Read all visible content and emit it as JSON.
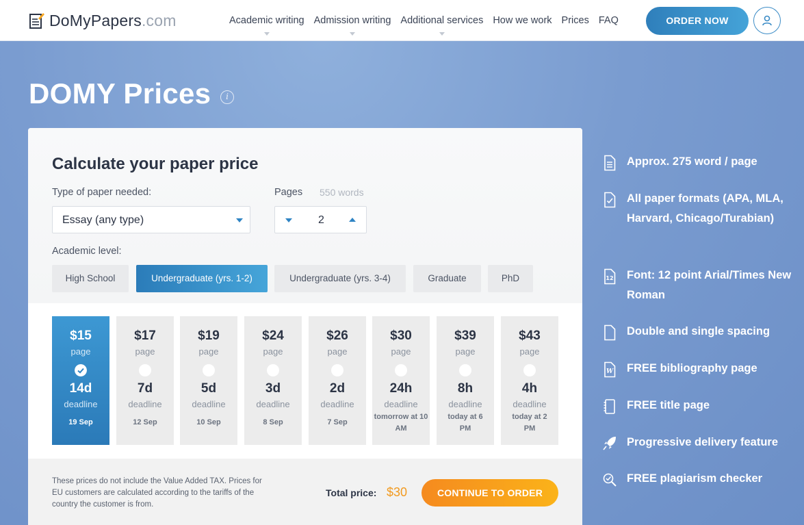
{
  "header": {
    "logo": {
      "main": "DoMyPapers",
      "suffix": ".com"
    },
    "nav": [
      {
        "label": "Academic writing",
        "has_dropdown": true
      },
      {
        "label": "Admission writing",
        "has_dropdown": true
      },
      {
        "label": "Additional services",
        "has_dropdown": true
      },
      {
        "label": "How we work",
        "has_dropdown": false
      },
      {
        "label": "Prices",
        "has_dropdown": false
      },
      {
        "label": "FAQ",
        "has_dropdown": false
      }
    ],
    "order_button": "ORDER NOW",
    "user_icon": "user-icon"
  },
  "page": {
    "title": "DOMY Prices",
    "info_glyph": "i"
  },
  "calculator": {
    "title": "Calculate your paper price",
    "type_label": "Type of paper needed:",
    "type_value": "Essay (any type)",
    "pages_label": "Pages",
    "words_hint": "550 words",
    "pages_value": "2",
    "level_label": "Academic level:",
    "levels": [
      {
        "label": "High School",
        "active": false
      },
      {
        "label": "Undergraduate (yrs. 1-2)",
        "active": true
      },
      {
        "label": "Undergraduate (yrs. 3-4)",
        "active": false
      },
      {
        "label": "Graduate",
        "active": false
      },
      {
        "label": "PhD",
        "active": false
      }
    ],
    "deadlines": [
      {
        "price": "$15",
        "unit": "page",
        "duration": "14d",
        "word": "deadline",
        "date": "19 Sep",
        "selected": true
      },
      {
        "price": "$17",
        "unit": "page",
        "duration": "7d",
        "word": "deadline",
        "date": "12 Sep",
        "selected": false
      },
      {
        "price": "$19",
        "unit": "page",
        "duration": "5d",
        "word": "deadline",
        "date": "10 Sep",
        "selected": false
      },
      {
        "price": "$24",
        "unit": "page",
        "duration": "3d",
        "word": "deadline",
        "date": "8 Sep",
        "selected": false
      },
      {
        "price": "$26",
        "unit": "page",
        "duration": "2d",
        "word": "deadline",
        "date": "7 Sep",
        "selected": false
      },
      {
        "price": "$30",
        "unit": "page",
        "duration": "24h",
        "word": "deadline",
        "date": "tomorrow at 10 AM",
        "selected": false
      },
      {
        "price": "$39",
        "unit": "page",
        "duration": "8h",
        "word": "deadline",
        "date": "today at 6 PM",
        "selected": false
      },
      {
        "price": "$43",
        "unit": "page",
        "duration": "4h",
        "word": "deadline",
        "date": "today at 2 PM",
        "selected": false
      }
    ],
    "vat_note": "These prices do not include the Value Added TAX. Prices for EU customers are calculated according to the tariffs of the country the customer is from.",
    "total_label": "Total price:",
    "total_value": "$30",
    "continue_button": "CONTINUE TO ORDER"
  },
  "features": [
    {
      "icon": "document-lines-icon",
      "text": "Approx. 275 word / page"
    },
    {
      "icon": "document-check-icon",
      "text": "All paper formats (APA, MLA, Harvard, Chicago/Turabian)"
    },
    {
      "icon": "font-size-icon",
      "text": "Font: 12 point Arial/Times New Roman"
    },
    {
      "icon": "blank-page-icon",
      "text": "Double and single spacing"
    },
    {
      "icon": "bibliography-icon",
      "text": "FREE bibliography page"
    },
    {
      "icon": "notebook-icon",
      "text": "FREE title page"
    },
    {
      "icon": "rocket-icon",
      "text": "Progressive delivery feature"
    },
    {
      "icon": "plagiarism-search-icon",
      "text": "FREE plagiarism checker"
    }
  ],
  "colors": {
    "brand_blue": "#2f84c4",
    "accent_orange": "#f7931e",
    "hero_bg": "#7a9bcf"
  }
}
